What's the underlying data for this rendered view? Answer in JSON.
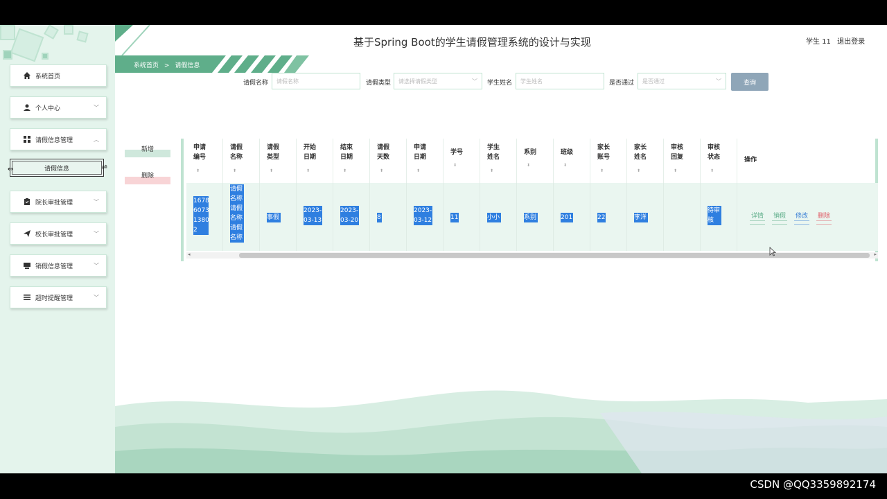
{
  "header": {
    "title": "基于Spring Boot的学生请假管理系统的设计与实现",
    "user": "学生 11",
    "logout": "退出登录"
  },
  "sidebar": {
    "items": [
      {
        "label": "系统首页",
        "icon": "home-icon"
      },
      {
        "label": "个人中心",
        "icon": "user-icon"
      },
      {
        "label": "请假信息管理",
        "icon": "grid-icon"
      },
      {
        "label": "院长审批管理",
        "icon": "clipboard-icon"
      },
      {
        "label": "校长审批管理",
        "icon": "send-icon"
      },
      {
        "label": "销假信息管理",
        "icon": "monitor-icon"
      },
      {
        "label": "超时提醒管理",
        "icon": "list-icon"
      }
    ],
    "subitem": "请假信息"
  },
  "breadcrumb": {
    "home": "系统首页",
    "sep": ">",
    "current": "请假信息"
  },
  "search": {
    "name_label": "请假名称",
    "name_placeholder": "请假名称",
    "type_label": "请假类型",
    "type_placeholder": "请选择请假类型",
    "student_label": "学生姓名",
    "student_placeholder": "学生姓名",
    "pass_label": "是否通过",
    "pass_placeholder": "是否通过",
    "query_button": "查询"
  },
  "actions": {
    "add": "新增",
    "delete": "删除"
  },
  "table": {
    "headers": [
      [
        "申请",
        "编号"
      ],
      [
        "请假",
        "名称"
      ],
      [
        "请假",
        "类型"
      ],
      [
        "开始",
        "日期"
      ],
      [
        "结束",
        "日期"
      ],
      [
        "请假",
        "天数"
      ],
      [
        "申请",
        "日期"
      ],
      [
        "学号"
      ],
      [
        "学生",
        "姓名"
      ],
      [
        "系别"
      ],
      [
        "班级"
      ],
      [
        "家长",
        "账号"
      ],
      [
        "家长",
        "姓名"
      ],
      [
        "审核",
        "回复"
      ],
      [
        "审核",
        "状态"
      ],
      [
        "操作"
      ]
    ],
    "row": {
      "id": [
        "1678",
        "6073",
        "1380",
        "2"
      ],
      "name": [
        "请假",
        "名称",
        "请假",
        "名称",
        "请假",
        "名称"
      ],
      "type": "事假",
      "start": [
        "2023-",
        "03-13"
      ],
      "end": [
        "2023-",
        "03-20"
      ],
      "days": "8",
      "apply": [
        "2023-",
        "03-12"
      ],
      "student_no": "11",
      "student_name": "小小",
      "dept": "系别",
      "class": "201",
      "parent_account": "22",
      "parent_name": "李洋",
      "reply": "",
      "status": [
        "待审",
        "核"
      ]
    },
    "ops": {
      "detail": "详情",
      "cancel_leave": "销假",
      "edit": "修改",
      "delete": "删除"
    }
  },
  "watermark": "CSDN @QQ3359892174",
  "colors": {
    "accent": "#5fae8a",
    "sidebar_bg": "#e4f4ec",
    "highlight": "#2f7fe0",
    "detail_link": "#5fae8a",
    "edit_link": "#3a7fd5",
    "delete_link": "#e0606a"
  }
}
